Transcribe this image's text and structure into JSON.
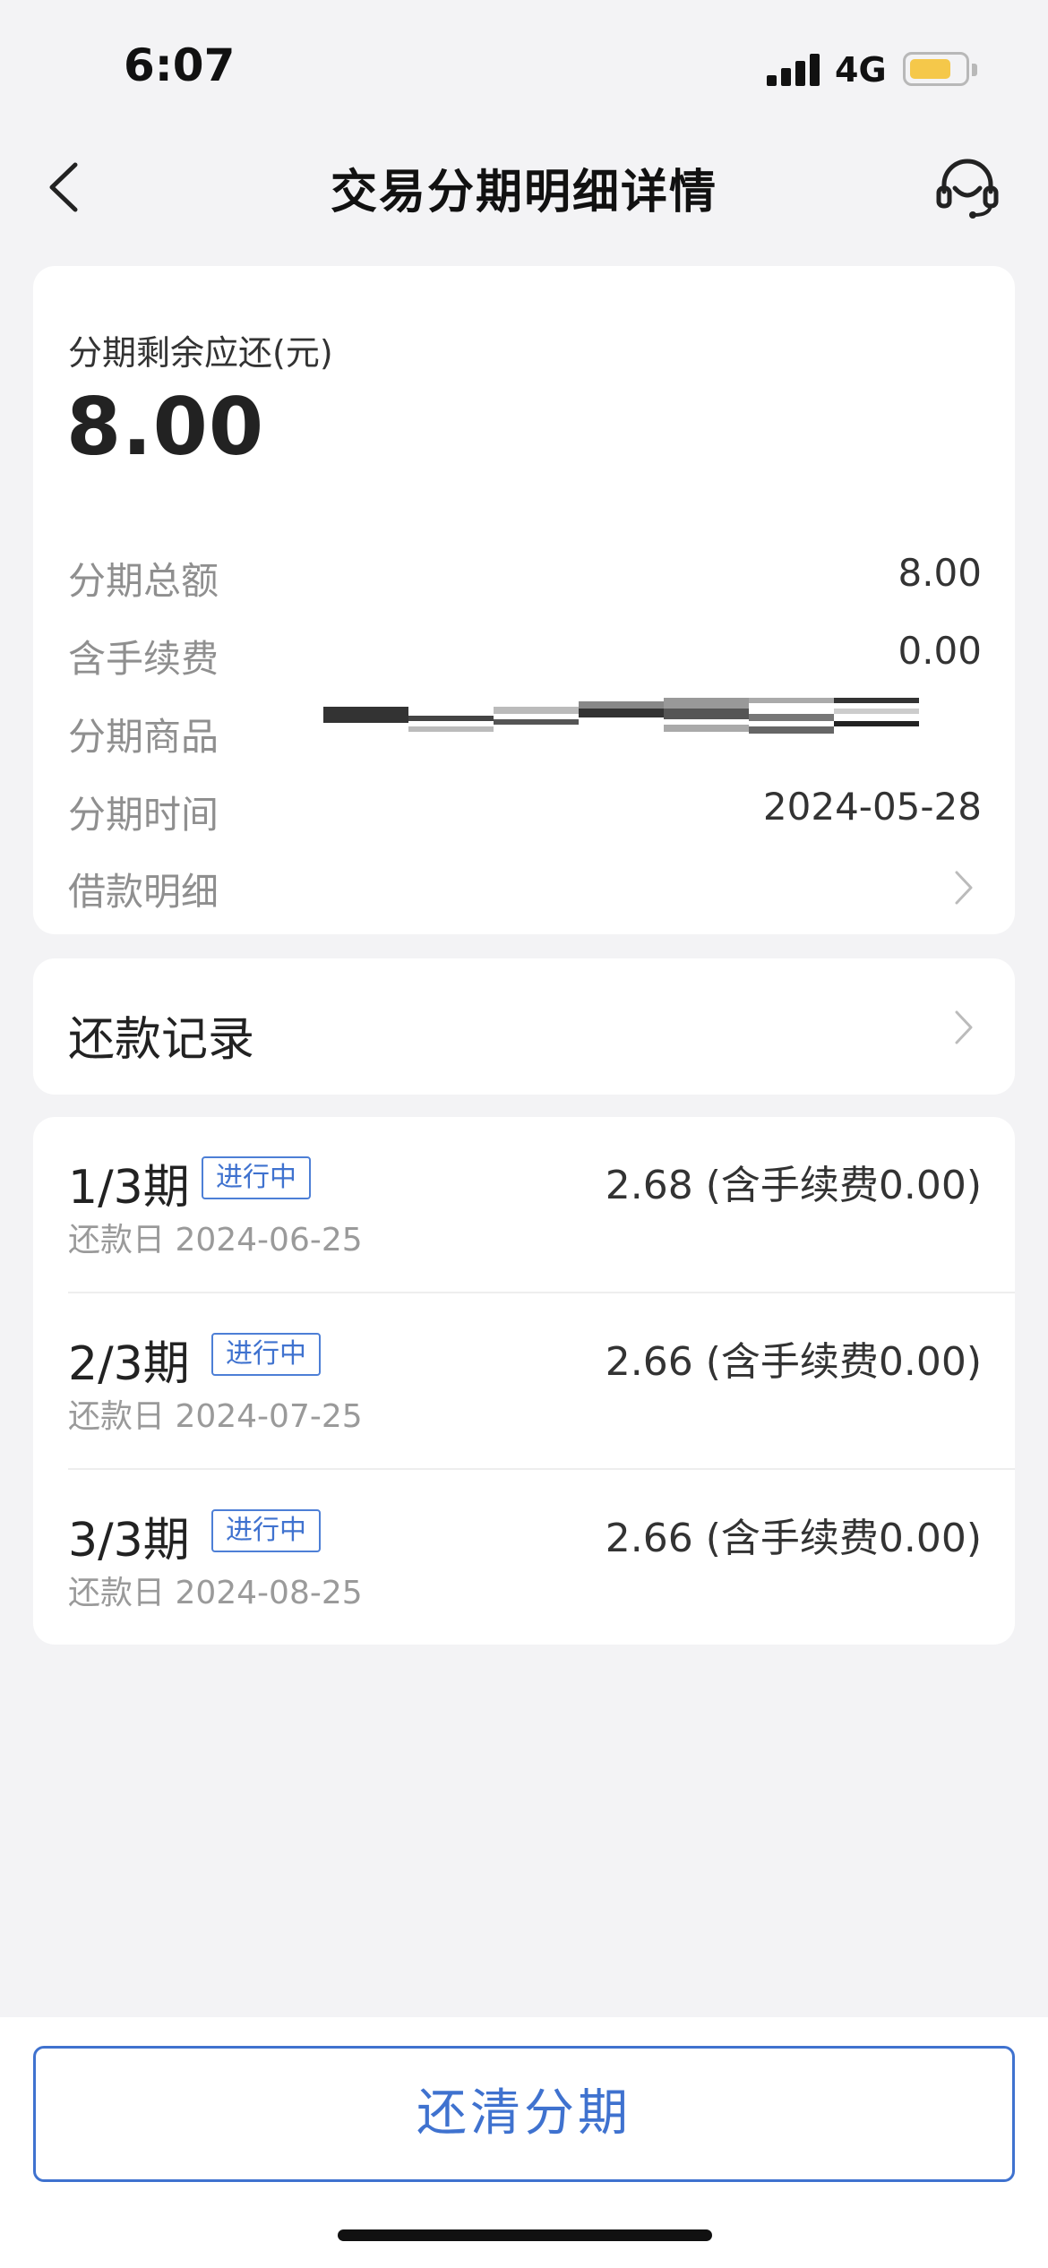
{
  "status_bar": {
    "time": "6:07",
    "network": "4G",
    "battery_color": "#f5c84a"
  },
  "nav": {
    "title": "交易分期明细详情",
    "back_icon": "chevron-left-icon",
    "service_icon": "headset-icon"
  },
  "summary": {
    "label": "分期剩余应还(元)",
    "amount": "8.00",
    "rows": {
      "total": {
        "label": "分期总额",
        "value": "8.00"
      },
      "fee": {
        "label": "含手续费",
        "value": "0.00"
      },
      "product": {
        "label": "分期商品"
      },
      "time": {
        "label": "分期时间",
        "value": "2024-05-28"
      },
      "loan": {
        "label": "借款明细"
      }
    }
  },
  "repay_record": {
    "label": "还款记录"
  },
  "plans": [
    {
      "period": "1/3期",
      "status": "进行中",
      "amount": "2.68 (含手续费0.00)",
      "date": "还款日 2024-06-25"
    },
    {
      "period": "2/3期",
      "status": "进行中",
      "amount": "2.66 (含手续费0.00)",
      "date": "还款日 2024-07-25"
    },
    {
      "period": "3/3期",
      "status": "进行中",
      "amount": "2.66 (含手续费0.00)",
      "date": "还款日 2024-08-25"
    }
  ],
  "bottom": {
    "button": "还清分期"
  },
  "colors": {
    "accent": "#3f72cf",
    "background": "#f3f3f5"
  }
}
